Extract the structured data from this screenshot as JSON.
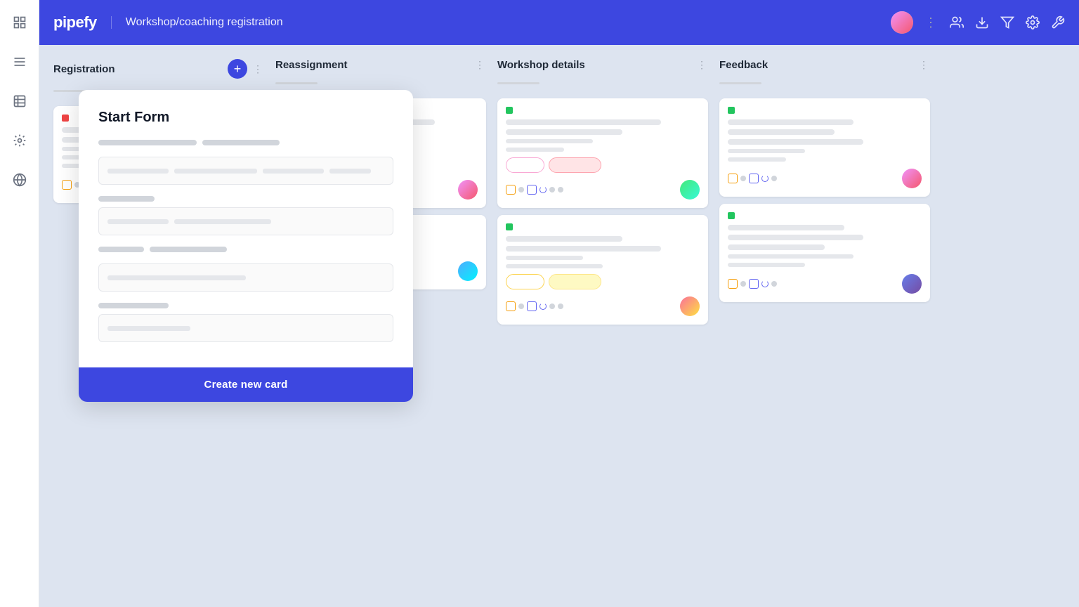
{
  "header": {
    "logo": "pipefy",
    "title": "Workshop/coaching registration",
    "user_avatar_alt": "User avatar"
  },
  "sidebar": {
    "items": [
      {
        "name": "grid-view",
        "icon": "grid"
      },
      {
        "name": "list-view",
        "icon": "list"
      },
      {
        "name": "table-view",
        "icon": "table"
      },
      {
        "name": "automation",
        "icon": "robot"
      },
      {
        "name": "global",
        "icon": "globe"
      }
    ]
  },
  "columns": [
    {
      "id": "registration",
      "title": "Registration",
      "has_add": true,
      "cards": [
        {
          "id": "card-r1",
          "tags": [
            "red"
          ],
          "lines": [
            4,
            3,
            2,
            2,
            2
          ],
          "badge": null,
          "avatar": "avatar-1",
          "icons": [
            "orange",
            "gray",
            "blue-sq",
            "blue-circle",
            "blue-circle",
            "gray-dot"
          ]
        }
      ]
    },
    {
      "id": "reassignment",
      "title": "Reassignment",
      "has_add": false,
      "cards": [
        {
          "id": "card-re1",
          "tags": [
            "red",
            "green"
          ],
          "lines": [
            3,
            3,
            2,
            2
          ],
          "badge": "gray",
          "badge2": "gray",
          "avatar": "avatar-2",
          "icons": [
            "orange",
            "gray",
            "blue-sq",
            "blue-circle",
            "gray-dot"
          ]
        },
        {
          "id": "card-re2",
          "tags": [],
          "lines": [
            2,
            2,
            1,
            1
          ],
          "badge": null,
          "avatar": "avatar-3",
          "icons": [
            "blue-sq",
            "blue-circle",
            "gray-dot"
          ]
        }
      ]
    },
    {
      "id": "workshop-details",
      "title": "Workshop details",
      "has_add": false,
      "cards": [
        {
          "id": "card-w1",
          "tags": [
            "green"
          ],
          "lines": [
            3,
            3,
            2,
            2
          ],
          "badge": "pink",
          "badge2": "pink-filled",
          "avatar": "avatar-4",
          "icons": [
            "orange",
            "gray",
            "blue-sq",
            "blue-circle",
            "gray-dot",
            "gray-dot"
          ]
        },
        {
          "id": "card-w2",
          "tags": [
            "green"
          ],
          "lines": [
            2,
            3,
            2,
            2
          ],
          "badge": "yellow",
          "badge2": "yellow-filled",
          "avatar": "avatar-5",
          "icons": [
            "orange",
            "gray",
            "blue-sq",
            "blue-circle",
            "gray-dot",
            "gray-dot"
          ]
        }
      ]
    },
    {
      "id": "feedback",
      "title": "Feedback",
      "has_add": false,
      "cards": [
        {
          "id": "card-f1",
          "tags": [
            "green"
          ],
          "lines": [
            2,
            3,
            2,
            2,
            2
          ],
          "badge": null,
          "avatar": "avatar-2",
          "icons": [
            "orange",
            "gray",
            "blue-sq",
            "blue-circle",
            "gray-dot"
          ]
        },
        {
          "id": "card-f2",
          "tags": [
            "green"
          ],
          "lines": [
            2,
            3,
            2,
            2,
            2
          ],
          "badge": null,
          "avatar": "avatar-1",
          "icons": [
            "orange",
            "gray",
            "blue-sq",
            "blue-circle",
            "gray-dot"
          ]
        }
      ]
    }
  ],
  "form": {
    "title": "Start Form",
    "field1_label": "field-label-1",
    "field2_label": "field-label-2",
    "field3_label": "field-label-3",
    "field4_label": "field-label-4",
    "create_button": "Create new card"
  }
}
